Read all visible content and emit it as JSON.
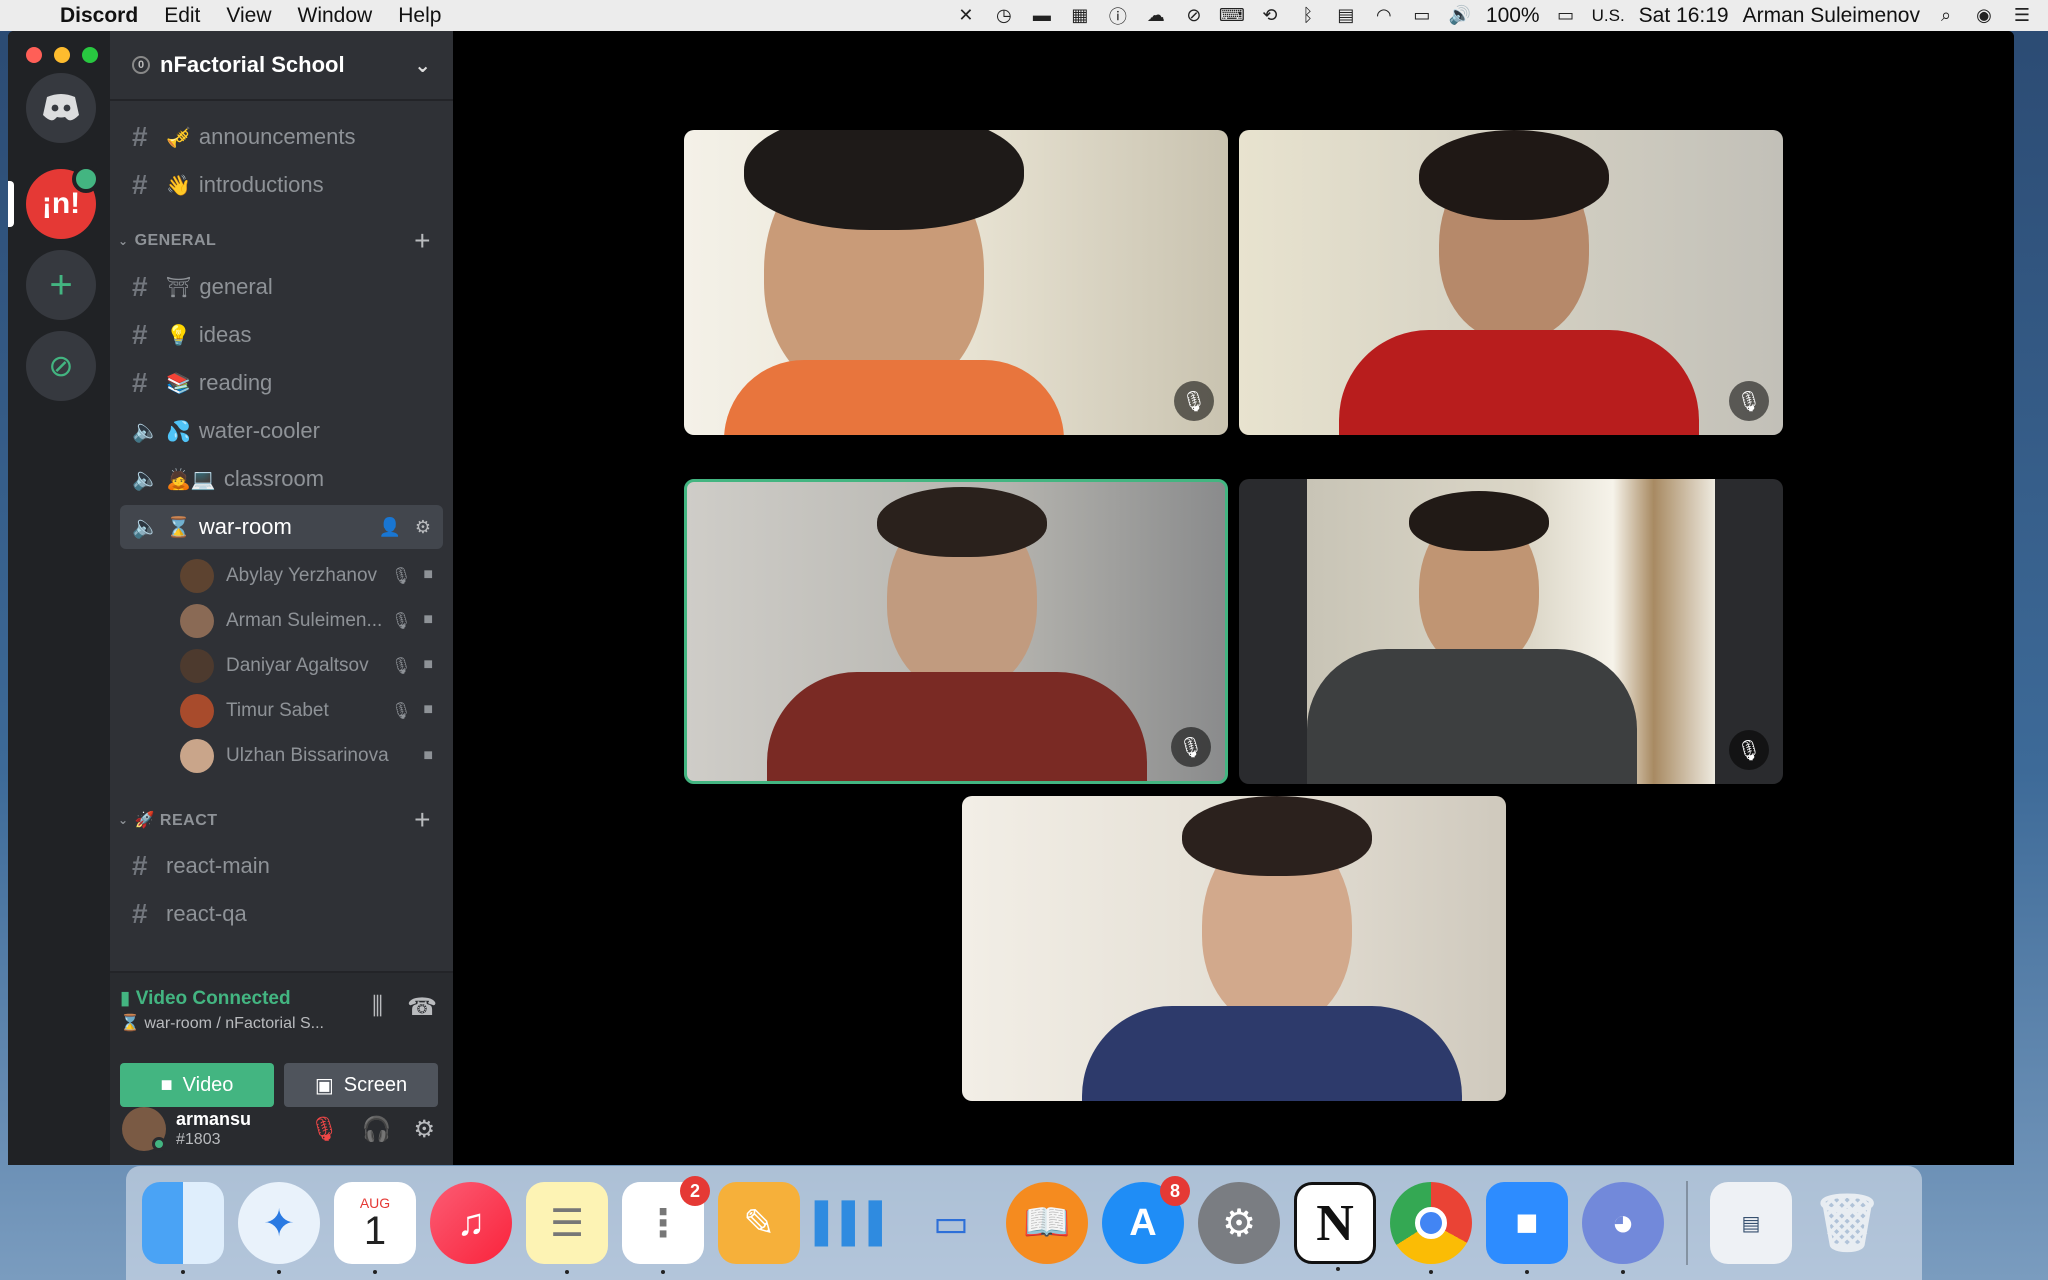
{
  "menubar": {
    "app": "Discord",
    "items": [
      "Edit",
      "View",
      "Window",
      "Help"
    ],
    "battery": "100%",
    "input": "U.S.",
    "clock": "Sat 16:19",
    "user": "Arman Suleimenov"
  },
  "server": {
    "name": "nFactorial School"
  },
  "channels_top": [
    {
      "emoji": "🎺",
      "name": "announcements"
    },
    {
      "emoji": "👋",
      "name": "introductions"
    }
  ],
  "category_general": "GENERAL",
  "channels_general": [
    {
      "type": "text",
      "emoji": "⛩",
      "name": "general"
    },
    {
      "type": "text",
      "emoji": "💡",
      "name": "ideas"
    },
    {
      "type": "text",
      "emoji": "📚",
      "name": "reading"
    },
    {
      "type": "voice",
      "emoji": "💦",
      "name": "water-cooler"
    },
    {
      "type": "voice",
      "emoji": "🙇💻",
      "name": "classroom"
    },
    {
      "type": "voice",
      "emoji": "⌛",
      "name": "war-room"
    }
  ],
  "voice_members": [
    "Abylay Yerzhanov",
    "Arman Suleimen...",
    "Daniyar Agaltsov",
    "Timur Sabet",
    "Ulzhan Bissarinova"
  ],
  "category_react": "🚀 REACT",
  "channels_react": [
    "react-main",
    "react-qa"
  ],
  "voice_panel": {
    "status": "Video Connected",
    "sub": "⌛ war-room / nFactorial S...",
    "video_label": "Video",
    "screen_label": "Screen"
  },
  "user": {
    "name": "armansu",
    "tag": "#1803"
  },
  "dock": {
    "calendar_month": "AUG",
    "calendar_day": "1",
    "reminders_badge": "2",
    "appstore_badge": "8"
  },
  "colors": {
    "accent_green": "#43b581",
    "sidebar": "#2f3136",
    "guilds": "#202225"
  }
}
